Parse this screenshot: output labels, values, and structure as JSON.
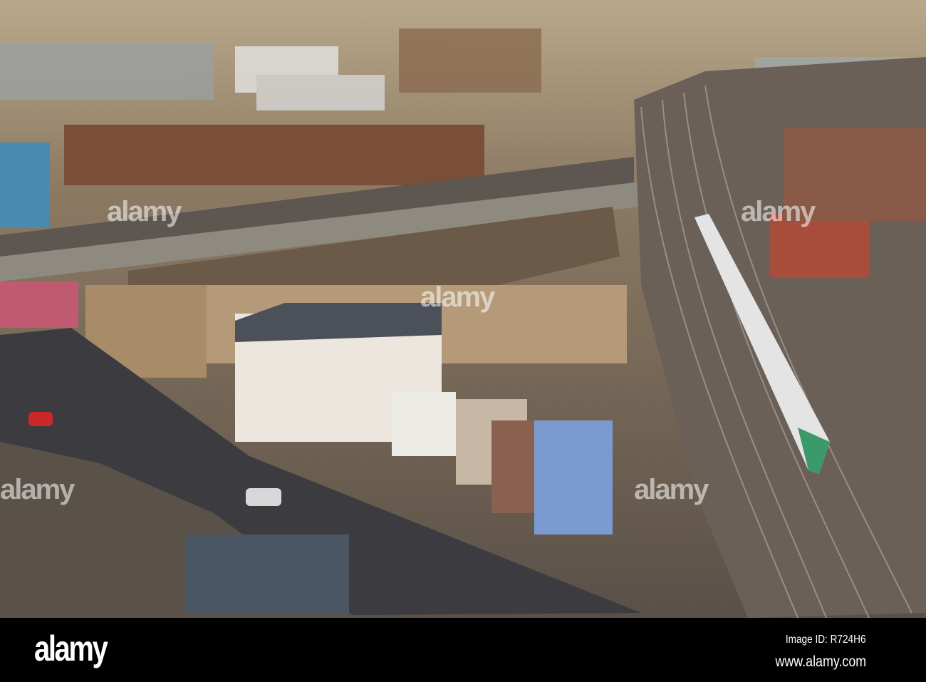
{
  "watermark": {
    "logo_text": "alamy"
  },
  "footer": {
    "logo": "alamy",
    "image_id": "Image ID: R724H6",
    "website": "www.alamy.com"
  }
}
